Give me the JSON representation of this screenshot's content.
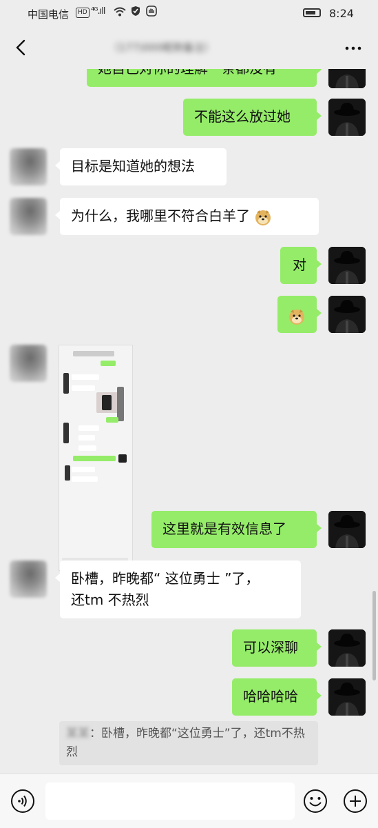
{
  "status_bar": {
    "carrier": "中国电信",
    "network_badge": "HD",
    "signal": "⁴ᴳ.ıll",
    "time": "8:24"
  },
  "header": {
    "contact_name": "（177)000昵称备注）",
    "back_icon": "chevron-left-icon",
    "more_icon": "more-dots-icon"
  },
  "messages": {
    "m0": "她自己对你的理解一条都没有",
    "m1": "不能这么放过她",
    "m2": "目标是知道她的想法",
    "m3": "为什么，我哪里不符合白羊了",
    "m4": "对",
    "m6": "这里就是有效信息了",
    "m7_line1": "卧槽，昨晚都“ 这位勇士 ”了，",
    "m7_line2": "还tm 不热烈",
    "m8": "可以深聊",
    "m9": "哈哈哈哈"
  },
  "quote": {
    "sender": "某某",
    "text": "：卧槽，昨晚都“这位勇士”了，还tm不热烈"
  },
  "input": {
    "value": ""
  },
  "colors": {
    "background": "#ededed",
    "sent_bubble": "#95ec69",
    "received_bubble": "#ffffff"
  }
}
